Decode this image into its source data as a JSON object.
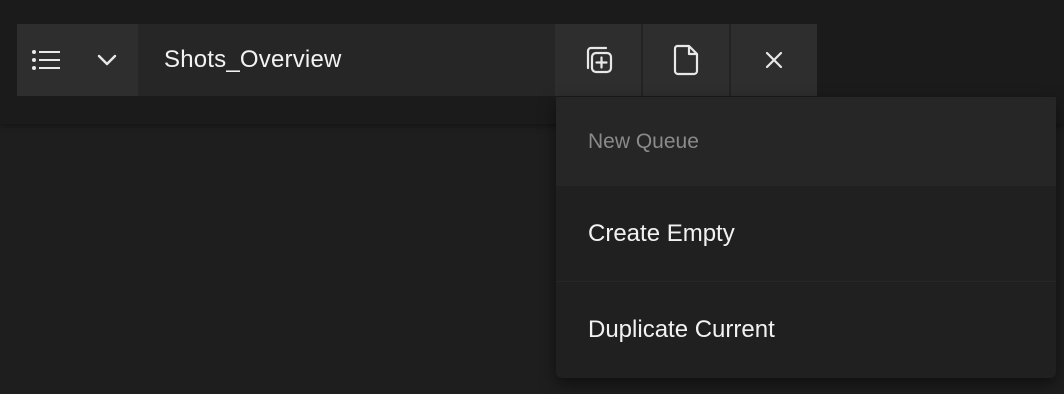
{
  "toolbar": {
    "list_icon": "list-icon",
    "chevron_icon": "chevron-down-icon",
    "title": "Shots_Overview",
    "new_queue_icon": "add-copy-icon",
    "file_icon": "file-icon",
    "close_icon": "close-icon"
  },
  "dropdown": {
    "header": "New Queue",
    "items": [
      {
        "label": "Create Empty"
      },
      {
        "label": "Duplicate Current"
      }
    ]
  },
  "colors": {
    "background": "#1e1e1e",
    "toolbar_button": "#2e2e2e",
    "title_field": "#262626",
    "menu": "#202020",
    "muted_text": "#8a8a8a",
    "text": "#f2f2f2"
  }
}
